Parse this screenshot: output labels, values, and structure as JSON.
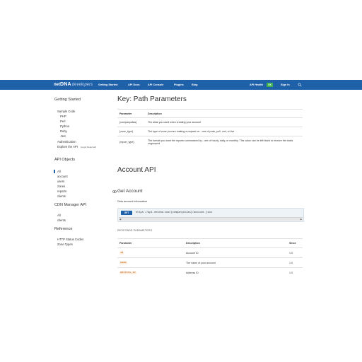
{
  "navbar": {
    "brand": {
      "prefix": "net",
      "name": "DNA",
      "suffix": "developers"
    },
    "links": [
      "Getting Started",
      "API Docs",
      "API Console",
      "Plugins",
      "Blog"
    ],
    "api_health_label": "API Health",
    "api_health_badge": "OK",
    "sign_in": "Sign In",
    "colors": {
      "bar": "#1f61a8",
      "badge": "#3fb24b"
    }
  },
  "sidebar": {
    "getting_started": "Getting Started",
    "sample_code": "Sample Code",
    "sample_langs": [
      "PHP",
      "Perl",
      "Python",
      "Ruby",
      ".Net"
    ],
    "authentication": "Authentication",
    "explore_api": "Explore the API",
    "login_required": "(Login Required)",
    "api_objects": "API Objects",
    "api_object_items": [
      "All",
      "account",
      "users",
      "zones",
      "reports",
      "clients"
    ],
    "cdn_manager": "CDN Manager API",
    "cdn_items": [
      "All",
      "clients"
    ],
    "reference": "Reference",
    "reference_items": [
      "HTTP Status Codes",
      "Zone Types"
    ]
  },
  "main": {
    "key_title": "Key: Path Parameters",
    "key_table": {
      "headers": [
        "Parameter",
        "Description"
      ],
      "rows": [
        [
          "{companyalias}",
          "The alias you used when creating your account"
        ],
        [
          "{zone_type}",
          "The type of zone you are making a request on - one of push, pull, vod, or live"
        ],
        [
          "{report_type}",
          "The format you want the reports summarized by - one of hourly, daily, or monthly. This value can be left blank to receive the totals ungrouped"
        ]
      ]
    },
    "account_api_title": "Account API",
    "get_account_title": "Get Account",
    "get_account_desc": "Gets account information",
    "endpoint": {
      "method": "GET",
      "url": "https://api.netdna.com/{companyalias}/account.json"
    },
    "response_params_label": "RESPONSE PARAMETERS",
    "response_table": {
      "headers": [
        "Parameter",
        "Description",
        "Since"
      ],
      "rows": [
        [
          "id",
          "Account ID",
          "1.0"
        ],
        [
          "name",
          "The name of your account",
          "1.0"
        ],
        [
          "address_id",
          "Address ID",
          "1.0"
        ]
      ]
    }
  }
}
